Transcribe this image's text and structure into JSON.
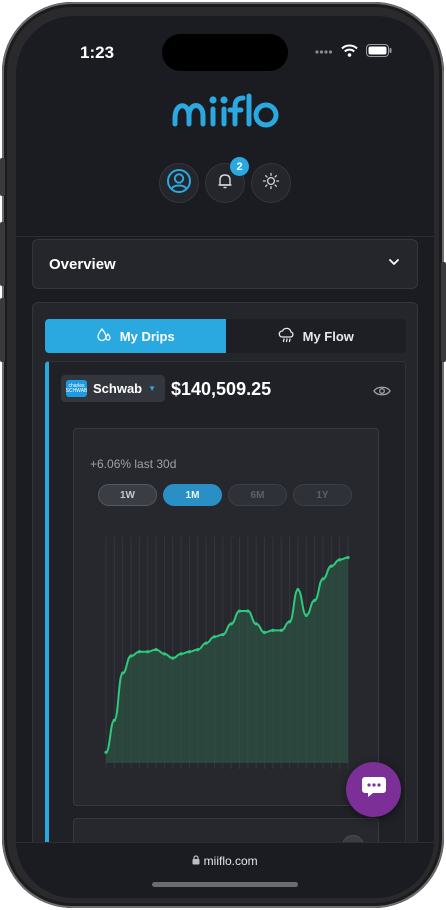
{
  "status_bar": {
    "time": "1:23"
  },
  "brand": {
    "name": "miiflo",
    "color": "#2aa8e0"
  },
  "header": {
    "profile_icon": "user-circle-icon",
    "notifications_icon": "bell-icon",
    "notification_count": "2",
    "theme_icon": "sun-icon"
  },
  "overview": {
    "title": "Overview",
    "toggle_icon": "chevron-down-icon"
  },
  "tabs": [
    {
      "label": "My Drips",
      "icon": "drops-icon",
      "active": true
    },
    {
      "label": "My Flow",
      "icon": "cloud-rain-icon",
      "active": false
    }
  ],
  "account": {
    "broker_name": "Schwab",
    "broker_logo_text": "charles SCHWAB",
    "balance": "$140,509.25",
    "visibility_icon": "eye-icon"
  },
  "performance": {
    "change_text": "+6.06% last 30d",
    "ranges": [
      {
        "label": "1W",
        "active": false
      },
      {
        "label": "1M",
        "active": true
      },
      {
        "label": "6M",
        "active": false
      },
      {
        "label": "1Y",
        "active": false
      }
    ]
  },
  "chart_data": {
    "type": "area",
    "series": [
      {
        "values": [
          0.05,
          0.2,
          0.42,
          0.5,
          0.52,
          0.52,
          0.53,
          0.51,
          0.49,
          0.51,
          0.52,
          0.53,
          0.56,
          0.59,
          0.6,
          0.65,
          0.71,
          0.71,
          0.65,
          0.61,
          0.62,
          0.62,
          0.66,
          0.81,
          0.69,
          0.76,
          0.86,
          0.92,
          0.95,
          0.96
        ]
      }
    ],
    "line_color": "#2ec97d",
    "fill_color": "#2f5a46",
    "grid": true,
    "axes_labels_visible": false
  },
  "chat": {
    "icon": "chat-bubble-icon",
    "color": "#7b2f97"
  },
  "browser": {
    "url": "miiflo.com",
    "lock_icon": "lock-icon"
  }
}
